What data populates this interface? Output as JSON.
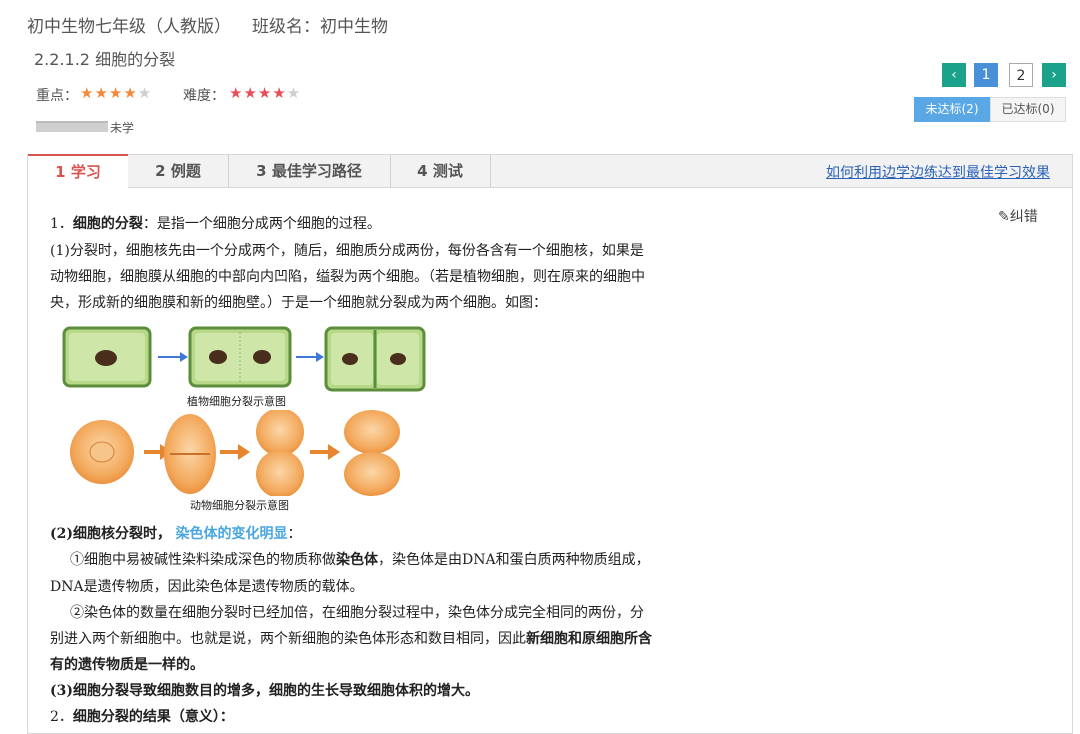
{
  "header": {
    "course_title": "初中生物七年级（人教版）",
    "class_name": "班级名：初中生物",
    "lesson_title": "2.2.1.2 细胞的分裂",
    "importance_label": "重点：",
    "importance_stars": 4,
    "difficulty_label": "难度：",
    "difficulty_stars": 4,
    "progress_label": "未学"
  },
  "pagination": {
    "prev": "‹",
    "pages": [
      "1",
      "2"
    ],
    "next": "›",
    "current": "1"
  },
  "status_tabs": {
    "not_met": "未达标(2)",
    "met": "已达标(0)"
  },
  "tabs": [
    "1 学习",
    "2 例题",
    "3 最佳学习路径",
    "4 测试"
  ],
  "help_link": "如何利用边学边练达到最佳学习效果",
  "correct_button": "纠错",
  "content": {
    "p1_num": "1．",
    "p1_bold": "细胞的分裂",
    "p1_rest": "：是指一个细胞分成两个细胞的过程。",
    "p2_l1": "(1)分裂时，细胞核先由一个分成两个，随后，细胞质分成两份，每份各含有一个细胞核，如果是",
    "p2_l2": "动物细胞，细胞膜从细胞的中部向内凹陷，缢裂为两个细胞。（若是植物细胞，则在原来的细胞中",
    "p2_l3": "央，形成新的细胞膜和新的细胞壁。）于是一个细胞就分裂成为两个细胞。如图：",
    "fig1_caption": "植物细胞分裂示意图",
    "fig2_caption": "动物细胞分裂示意图",
    "p3_bold": "(2)细胞核分裂时，",
    "p3_blue": "染色体的变化明显",
    "p3_colon": "：",
    "p4_a": "①细胞中易被碱性染料染成深色的物质称做",
    "p4_b": "染色体",
    "p4_c": "，染色体是由DNA和蛋白质两种物质组成，",
    "p4_l2": "DNA是遗传物质，因此染色体是遗传物质的载体。",
    "p5_l1": "②染色体的数量在细胞分裂时已经加倍，在细胞分裂过程中，染色体分成完全相同的两份，分",
    "p5_l2a": "别进入两个新细胞中。也就是说，两个新细胞的染色体形态和数目相同，因此",
    "p5_l2b": "新细胞和原细胞所含",
    "p5_l3": "有的遗传物质是一样的。",
    "p6": "(3)细胞分裂导致细胞数目的增多，细胞的生长导致细胞体积的增大。",
    "p7_num": "2．",
    "p7_bold": "细胞分裂的结果（意义）："
  }
}
